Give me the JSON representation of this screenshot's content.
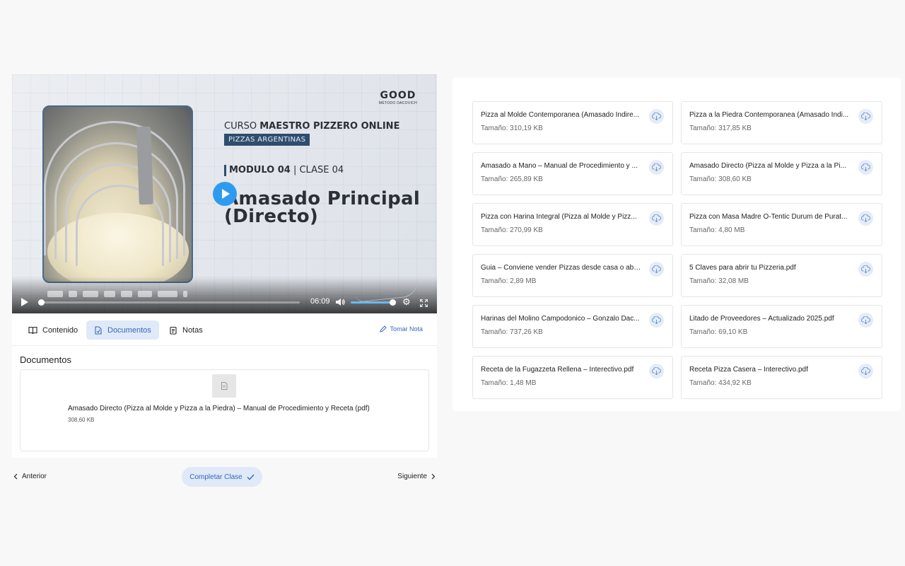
{
  "video": {
    "logo_main": "GOOD",
    "logo_sub": "MÉTODO DACOVICH",
    "curso_prefix": "CURSO ",
    "curso_bold": "MAESTRO PIZZERO ONLINE",
    "category": "PIZZAS ARGENTINAS",
    "modulo_bold": "MODULO 04",
    "modulo_rest": " | CLASE 04",
    "lesson_title": "Amasado Principal (Directo)",
    "current_time": "06:09",
    "progress_fraction": 0.0,
    "volume_fraction": 1.0
  },
  "tabs": {
    "contenido": "Contenido",
    "documentos": "Documentos",
    "notas": "Notas",
    "active": "documentos",
    "tomar_nota": "Tomar Nota"
  },
  "documents_section": {
    "title": "Documentos",
    "item": {
      "name": "Amasado Directo (Pizza al Molde y Pizza a la Piedra) – Manual de Procedimiento y Receta (pdf)",
      "size": "308,60 KB"
    }
  },
  "nav": {
    "anterior": "Anterior",
    "completar": "Completar Clase",
    "siguiente": "Siguiente"
  },
  "files": [
    {
      "name": "Pizza al Molde Contemporanea (Amasado Indire...",
      "size": "Tamaño: 310,19 KB"
    },
    {
      "name": "Pizza a la Piedra Contemporanea (Amasado Indi...",
      "size": "Tamaño: 317,85 KB"
    },
    {
      "name": "Amasado a Mano – Manual de Procedimiento y ...",
      "size": "Tamaño: 265,89 KB"
    },
    {
      "name": "Amasado Directo (Pizza al Molde y Pizza a la Pi...",
      "size": "Tamaño: 308,60 KB"
    },
    {
      "name": "Pizza con Harina Integral (Pizza al Molde y Pizz...",
      "size": "Tamaño: 270,99 KB"
    },
    {
      "name": "Pizza con Masa Madre O-Tentic Durum de Purat...",
      "size": "Tamaño: 4,80 MB"
    },
    {
      "name": "Guia – Conviene vender Pizzas desde casa o abri...",
      "size": "Tamaño: 2,89 MB"
    },
    {
      "name": "5 Claves para abrir tu Pizzeria.pdf",
      "size": "Tamaño: 32,08 MB"
    },
    {
      "name": "Harinas del Molino Campodonico – Gonzalo Dac...",
      "size": "Tamaño: 737,26 KB"
    },
    {
      "name": "Litado de Proveedores – Actualizado 2025.pdf",
      "size": "Tamaño: 69,10 KB"
    },
    {
      "name": "Receta de la Fugazzeta Rellena – Interectivo.pdf",
      "size": "Tamaño: 1,48 MB"
    },
    {
      "name": "Receta Pizza Casera – Interectivo.pdf",
      "size": "Tamaño: 434,92 KB"
    }
  ],
  "colors": {
    "accent": "#3567b9",
    "accent_bg": "#dfe9f8",
    "play_button": "#2f9bf0",
    "category_pill": "#2f4d6e"
  },
  "icons": {
    "download": "cloud-download-icon",
    "book": "book-icon",
    "document": "document-icon",
    "notes": "notes-icon",
    "pen": "pen-icon",
    "check": "check-icon"
  }
}
